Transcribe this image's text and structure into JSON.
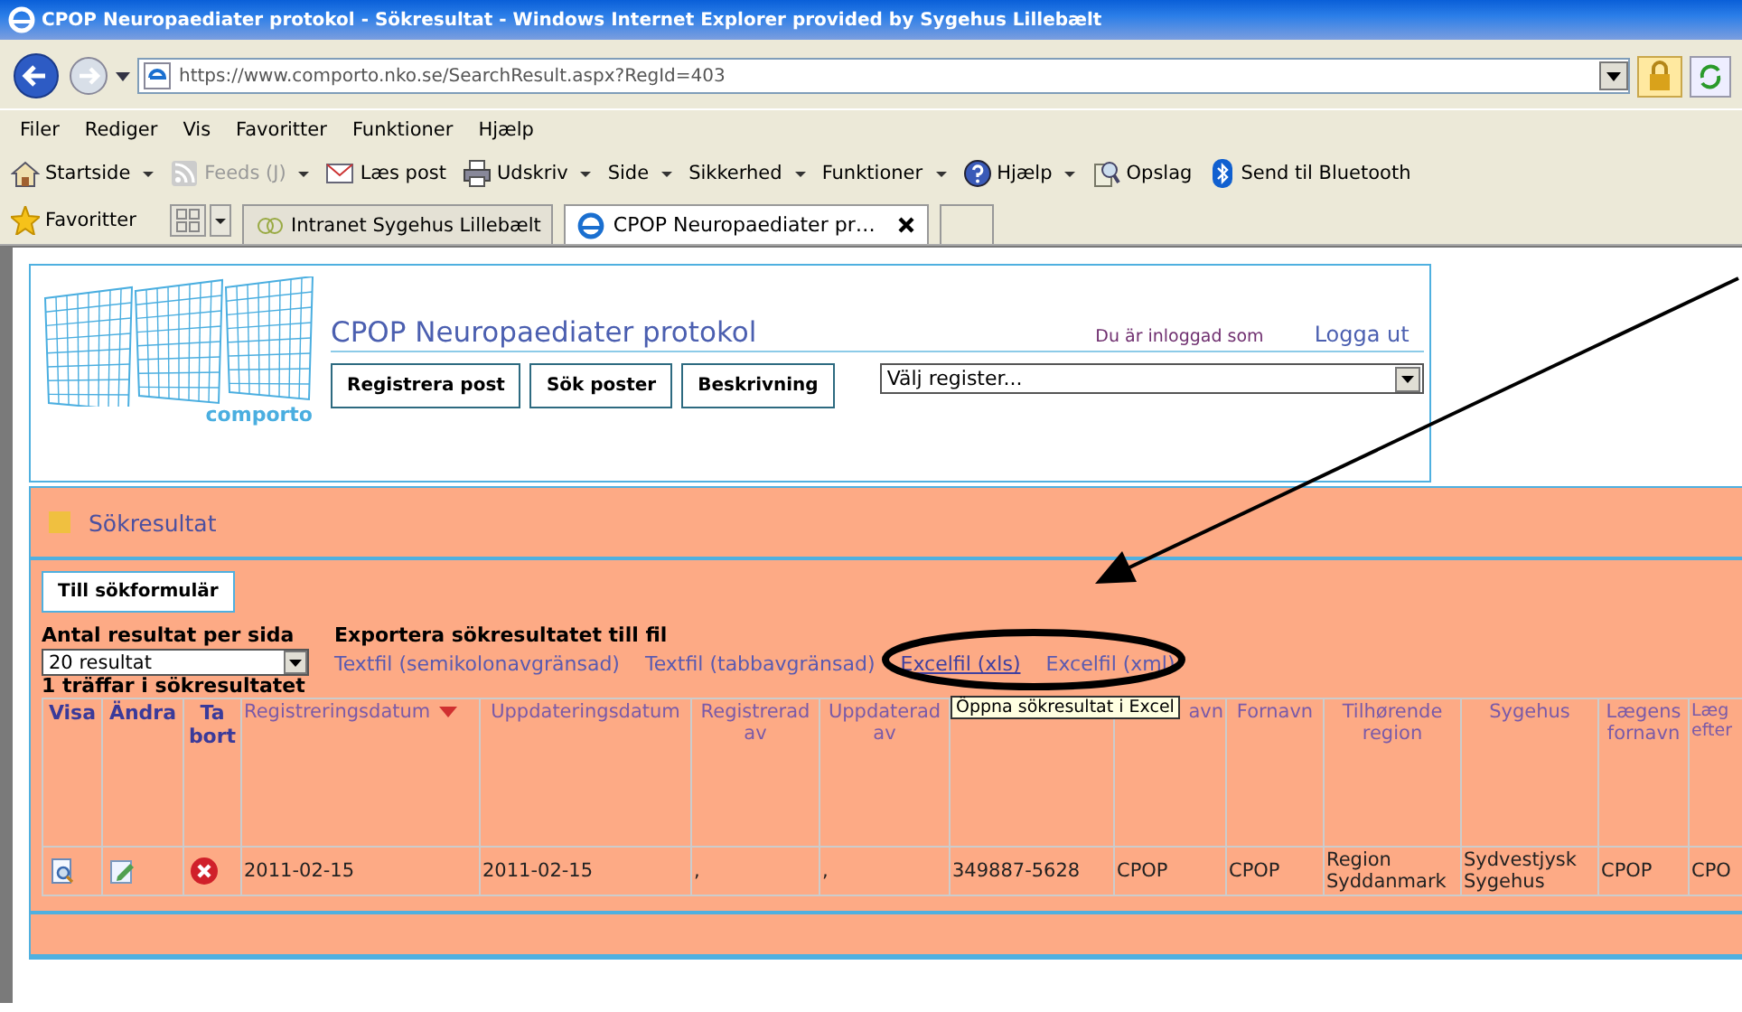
{
  "window": {
    "title": "CPOP Neuropaediater protokol - Sökresultat - Windows Internet Explorer provided by Sygehus Lillebælt"
  },
  "address_bar": {
    "url": "https://www.comporto.nko.se/SearchResult.aspx?RegId=403"
  },
  "menu": [
    "Filer",
    "Rediger",
    "Vis",
    "Favoritter",
    "Funktioner",
    "Hjælp"
  ],
  "command_bar": [
    {
      "label": "Startside",
      "kind": "home",
      "dropdown": true,
      "disabled": false
    },
    {
      "label": "Feeds (J)",
      "kind": "feed",
      "dropdown": true,
      "disabled": true
    },
    {
      "label": "Læs post",
      "kind": "mail",
      "dropdown": false,
      "disabled": false
    },
    {
      "label": "Udskriv",
      "kind": "print",
      "dropdown": true,
      "disabled": false
    },
    {
      "label": "Side",
      "kind": "text",
      "dropdown": true,
      "disabled": false
    },
    {
      "label": "Sikkerhed",
      "kind": "text",
      "dropdown": true,
      "disabled": false
    },
    {
      "label": "Funktioner",
      "kind": "text",
      "dropdown": true,
      "disabled": false
    },
    {
      "label": "Hjælp",
      "kind": "help",
      "dropdown": true,
      "disabled": false
    },
    {
      "label": "Opslag",
      "kind": "research",
      "dropdown": false,
      "disabled": false
    },
    {
      "label": "Send til Bluetooth",
      "kind": "bluetooth",
      "dropdown": false,
      "disabled": false
    }
  ],
  "favorites_bar": {
    "label": "Favoritter",
    "tabs": [
      {
        "label": "Intranet Sygehus Lillebælt",
        "selected": false
      },
      {
        "label": "CPOP Neuropaediater pr…",
        "selected": true
      }
    ]
  },
  "site": {
    "logo_text": "comporto",
    "title": "CPOP Neuropaediater protokol",
    "login_text": "Du är inloggad som",
    "logout": "Logga ut",
    "buttons": [
      "Registrera post",
      "Sök poster",
      "Beskrivning"
    ],
    "register_select": "Välj register..."
  },
  "results": {
    "heading": "Sökresultat",
    "back_button": "Till sökformulär",
    "per_page_label": "Antal resultat per sida",
    "per_page_value": "20 resultat",
    "export_label": "Exportera sökresultatet till fil",
    "export_links": [
      {
        "label": "Textfil (semikolonavgränsad)",
        "hovered": false
      },
      {
        "label": "Textfil (tabbavgränsad)",
        "hovered": false
      },
      {
        "label": "Excelfil (xls)",
        "hovered": true
      },
      {
        "label": "Excelfil (xml)",
        "hovered": false
      }
    ],
    "tooltip": "Öppna sökresultat i Excel",
    "count_text": "1 träffar i sökresultatet",
    "table": {
      "columns": [
        {
          "label": "Visa",
          "kind": "action",
          "sorted": false
        },
        {
          "label": "Ändra",
          "kind": "action",
          "sorted": false
        },
        {
          "label": "Ta bort",
          "kind": "action",
          "sorted": false
        },
        {
          "label": "Registreringsdatum",
          "kind": "data",
          "sorted": true
        },
        {
          "label": "Uppdateringsdatum",
          "kind": "data",
          "sorted": false
        },
        {
          "label": "Registrerad av",
          "kind": "data",
          "sorted": false
        },
        {
          "label": "Uppdaterad av",
          "kind": "data",
          "sorted": false
        },
        {
          "kind": "data"
        },
        {
          "label": "avn",
          "kind": "data",
          "sorted": false
        },
        {
          "label": "Fornavn",
          "kind": "data",
          "sorted": false
        },
        {
          "label": "Tilhørende region",
          "kind": "data",
          "sorted": false
        },
        {
          "label": "Sygehus",
          "kind": "data",
          "sorted": false
        },
        {
          "label": "Lægens fornavn",
          "kind": "data",
          "sorted": false
        },
        {
          "label": "Læg efter",
          "kind": "data"
        }
      ],
      "rows": [
        {
          "cells": [
            {
              "kind": "view"
            },
            {
              "kind": "edit"
            },
            {
              "kind": "delete"
            },
            {
              "kind": "text",
              "text": "2011-02-15"
            },
            {
              "kind": "text",
              "text": "2011-02-15"
            },
            {
              "kind": "text",
              "text": ","
            },
            {
              "kind": "text",
              "text": ","
            },
            {
              "kind": "text",
              "text": "349887-5628"
            },
            {
              "kind": "text",
              "text": "CPOP"
            },
            {
              "kind": "text",
              "text": "CPOP"
            },
            {
              "kind": "text",
              "text": "Region Syddanmark"
            },
            {
              "kind": "text",
              "text": "Sydvestjysk Sygehus"
            },
            {
              "kind": "text",
              "text": "CPOP"
            },
            {
              "kind": "text",
              "text": "CPO"
            }
          ]
        }
      ]
    }
  }
}
